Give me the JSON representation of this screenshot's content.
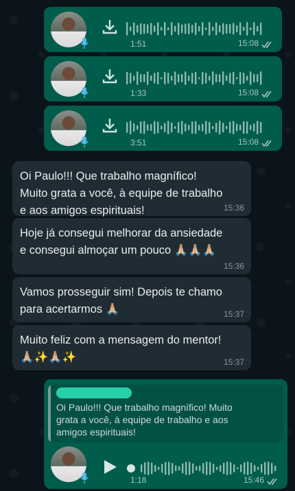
{
  "colors": {
    "background": "#0b141a",
    "outgoing_bubble": "#005c4b",
    "incoming_bubble": "#202c33",
    "read_ticks": "#53bdeb"
  },
  "voice_messages": [
    {
      "duration": "1:51",
      "time": "15:08"
    },
    {
      "duration": "1:33",
      "time": "15:08"
    },
    {
      "duration": "3:51",
      "time": "15:08"
    }
  ],
  "incoming_messages": [
    {
      "text": "Oi Paulo!!! Que trabalho magnífico!\nMuito grata a você, à equipe de trabalho\ne aos amigos espirituais!",
      "time": "15:36"
    },
    {
      "text": "Hoje já consegui melhorar da ansiedade\ne consegui almoçar um pouco 🙏🏼🙏🏼🙏🏼",
      "time": "15:36"
    },
    {
      "text": "Vamos prosseguir sim! Depois te chamo\npara acertarmos 🙏🏼",
      "time": "15:37"
    },
    {
      "text": "Muito feliz com a mensagem do mentor!\n🙏🏼✨🙏🏼✨",
      "time": "15:37"
    }
  ],
  "reply_message": {
    "quoted_text": "Oi Paulo!!! Que trabalho magnífico! Muito\ngrata a você, à equipe de trabalho e aos\namigos espirituais!",
    "duration": "1:18",
    "time": "15:46"
  },
  "icons": {
    "download": "download-icon",
    "mic": "mic-icon",
    "play": "play-icon",
    "read_receipt": "double-check-icon"
  }
}
